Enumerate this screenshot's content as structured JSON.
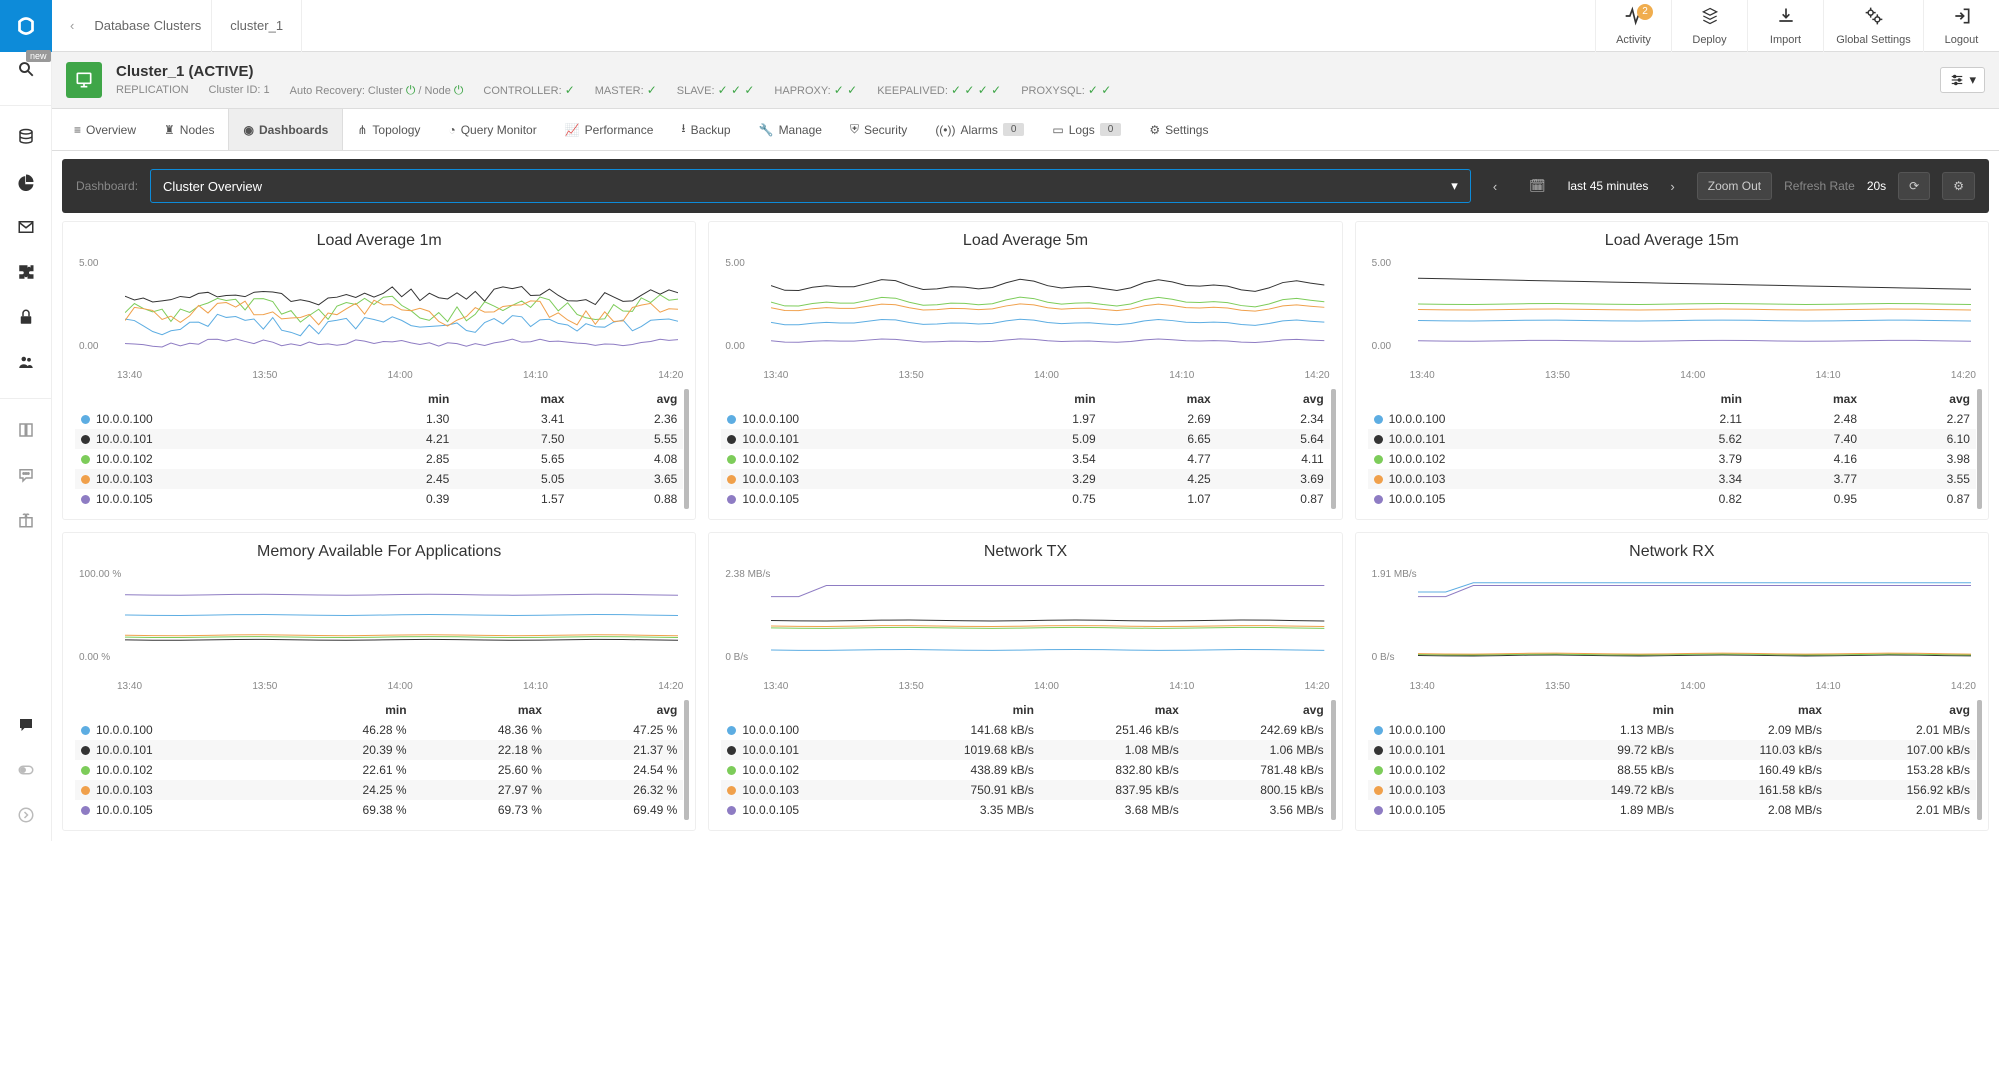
{
  "breadcrumb": {
    "parent": "Database Clusters",
    "current": "cluster_1"
  },
  "top_actions": {
    "activity": "Activity",
    "activity_badge": "2",
    "deploy": "Deploy",
    "import": "Import",
    "global_settings": "Global Settings",
    "logout": "Logout"
  },
  "left_rail": {
    "new_label": "new"
  },
  "cluster": {
    "title": "Cluster_1 (ACTIVE)",
    "replication": "REPLICATION",
    "cluster_id_label": "Cluster ID: 1",
    "auto_recovery": "Auto Recovery: Cluster",
    "node_label": "/ Node",
    "controller": "CONTROLLER:",
    "master": "MASTER:",
    "slave": "SLAVE:",
    "haproxy": "HAPROXY:",
    "keepalived": "KEEPALIVED:",
    "proxysql": "PROXYSQL:"
  },
  "tabs": {
    "overview": "Overview",
    "nodes": "Nodes",
    "dashboards": "Dashboards",
    "topology": "Topology",
    "query_monitor": "Query Monitor",
    "performance": "Performance",
    "backup": "Backup",
    "manage": "Manage",
    "security": "Security",
    "alarms": "Alarms",
    "alarms_count": "0",
    "logs": "Logs",
    "logs_count": "0",
    "settings": "Settings"
  },
  "toolbar": {
    "dashboard_label": "Dashboard:",
    "selected": "Cluster Overview",
    "time_range": "last 45 minutes",
    "zoom_out": "Zoom Out",
    "refresh_label": "Refresh Rate",
    "refresh_value": "20s"
  },
  "chart_common": {
    "x_ticks": [
      "13:40",
      "13:50",
      "14:00",
      "14:10",
      "14:20"
    ],
    "stat_headers": [
      "min",
      "max",
      "avg"
    ]
  },
  "series_palette": {
    "10.0.0.100": "#5dade2",
    "10.0.0.101": "#333333",
    "10.0.0.102": "#7dcc5a",
    "10.0.0.103": "#f0a04b",
    "10.0.0.105": "#8e7cc3"
  },
  "chart_data": [
    {
      "id": "load1m",
      "title": "Load Average 1m",
      "type": "line",
      "y_ticks": [
        "5.00",
        "0.00"
      ],
      "x_ticks": [
        "13:40",
        "13:50",
        "14:00",
        "14:10",
        "14:20"
      ],
      "series": [
        {
          "name": "10.0.0.100",
          "stats": {
            "min": "1.30",
            "max": "3.41",
            "avg": "2.36"
          }
        },
        {
          "name": "10.0.0.101",
          "stats": {
            "min": "4.21",
            "max": "7.50",
            "avg": "5.55"
          }
        },
        {
          "name": "10.0.0.102",
          "stats": {
            "min": "2.85",
            "max": "5.65",
            "avg": "4.08"
          }
        },
        {
          "name": "10.0.0.103",
          "stats": {
            "min": "2.45",
            "max": "5.05",
            "avg": "3.65"
          }
        },
        {
          "name": "10.0.0.105",
          "stats": {
            "min": "0.39",
            "max": "1.57",
            "avg": "0.88"
          }
        }
      ]
    },
    {
      "id": "load5m",
      "title": "Load Average 5m",
      "type": "line",
      "y_ticks": [
        "5.00",
        "0.00"
      ],
      "x_ticks": [
        "13:40",
        "13:50",
        "14:00",
        "14:10",
        "14:20"
      ],
      "series": [
        {
          "name": "10.0.0.100",
          "stats": {
            "min": "1.97",
            "max": "2.69",
            "avg": "2.34"
          }
        },
        {
          "name": "10.0.0.101",
          "stats": {
            "min": "5.09",
            "max": "6.65",
            "avg": "5.64"
          }
        },
        {
          "name": "10.0.0.102",
          "stats": {
            "min": "3.54",
            "max": "4.77",
            "avg": "4.11"
          }
        },
        {
          "name": "10.0.0.103",
          "stats": {
            "min": "3.29",
            "max": "4.25",
            "avg": "3.69"
          }
        },
        {
          "name": "10.0.0.105",
          "stats": {
            "min": "0.75",
            "max": "1.07",
            "avg": "0.87"
          }
        }
      ]
    },
    {
      "id": "load15m",
      "title": "Load Average 15m",
      "type": "line",
      "y_ticks": [
        "5.00",
        "0.00"
      ],
      "x_ticks": [
        "13:40",
        "13:50",
        "14:00",
        "14:10",
        "14:20"
      ],
      "series": [
        {
          "name": "10.0.0.100",
          "stats": {
            "min": "2.11",
            "max": "2.48",
            "avg": "2.27"
          }
        },
        {
          "name": "10.0.0.101",
          "stats": {
            "min": "5.62",
            "max": "7.40",
            "avg": "6.10"
          }
        },
        {
          "name": "10.0.0.102",
          "stats": {
            "min": "3.79",
            "max": "4.16",
            "avg": "3.98"
          }
        },
        {
          "name": "10.0.0.103",
          "stats": {
            "min": "3.34",
            "max": "3.77",
            "avg": "3.55"
          }
        },
        {
          "name": "10.0.0.105",
          "stats": {
            "min": "0.82",
            "max": "0.95",
            "avg": "0.87"
          }
        }
      ]
    },
    {
      "id": "mem",
      "title": "Memory Available For Applications",
      "type": "line",
      "y_ticks": [
        "100.00 %",
        "0.00 %"
      ],
      "x_ticks": [
        "13:40",
        "13:50",
        "14:00",
        "14:10",
        "14:20"
      ],
      "series": [
        {
          "name": "10.0.0.100",
          "stats": {
            "min": "46.28 %",
            "max": "48.36 %",
            "avg": "47.25 %"
          }
        },
        {
          "name": "10.0.0.101",
          "stats": {
            "min": "20.39 %",
            "max": "22.18 %",
            "avg": "21.37 %"
          }
        },
        {
          "name": "10.0.0.102",
          "stats": {
            "min": "22.61 %",
            "max": "25.60 %",
            "avg": "24.54 %"
          }
        },
        {
          "name": "10.0.0.103",
          "stats": {
            "min": "24.25 %",
            "max": "27.97 %",
            "avg": "26.32 %"
          }
        },
        {
          "name": "10.0.0.105",
          "stats": {
            "min": "69.38 %",
            "max": "69.73 %",
            "avg": "69.49 %"
          }
        }
      ]
    },
    {
      "id": "nettx",
      "title": "Network TX",
      "type": "line",
      "y_ticks": [
        "2.38 MB/s",
        "0 B/s"
      ],
      "x_ticks": [
        "13:40",
        "13:50",
        "14:00",
        "14:10",
        "14:20"
      ],
      "series": [
        {
          "name": "10.0.0.100",
          "stats": {
            "min": "141.68 kB/s",
            "max": "251.46 kB/s",
            "avg": "242.69 kB/s"
          }
        },
        {
          "name": "10.0.0.101",
          "stats": {
            "min": "1019.68 kB/s",
            "max": "1.08 MB/s",
            "avg": "1.06 MB/s"
          }
        },
        {
          "name": "10.0.0.102",
          "stats": {
            "min": "438.89 kB/s",
            "max": "832.80 kB/s",
            "avg": "781.48 kB/s"
          }
        },
        {
          "name": "10.0.0.103",
          "stats": {
            "min": "750.91 kB/s",
            "max": "837.95 kB/s",
            "avg": "800.15 kB/s"
          }
        },
        {
          "name": "10.0.0.105",
          "stats": {
            "min": "3.35 MB/s",
            "max": "3.68 MB/s",
            "avg": "3.56 MB/s"
          }
        }
      ]
    },
    {
      "id": "netrx",
      "title": "Network RX",
      "type": "line",
      "y_ticks": [
        "1.91 MB/s",
        "0 B/s"
      ],
      "x_ticks": [
        "13:40",
        "13:50",
        "14:00",
        "14:10",
        "14:20"
      ],
      "series": [
        {
          "name": "10.0.0.100",
          "stats": {
            "min": "1.13 MB/s",
            "max": "2.09 MB/s",
            "avg": "2.01 MB/s"
          }
        },
        {
          "name": "10.0.0.101",
          "stats": {
            "min": "99.72 kB/s",
            "max": "110.03 kB/s",
            "avg": "107.00 kB/s"
          }
        },
        {
          "name": "10.0.0.102",
          "stats": {
            "min": "88.55 kB/s",
            "max": "160.49 kB/s",
            "avg": "153.28 kB/s"
          }
        },
        {
          "name": "10.0.0.103",
          "stats": {
            "min": "149.72 kB/s",
            "max": "161.58 kB/s",
            "avg": "156.92 kB/s"
          }
        },
        {
          "name": "10.0.0.105",
          "stats": {
            "min": "1.89 MB/s",
            "max": "2.08 MB/s",
            "avg": "2.01 MB/s"
          }
        }
      ]
    }
  ]
}
